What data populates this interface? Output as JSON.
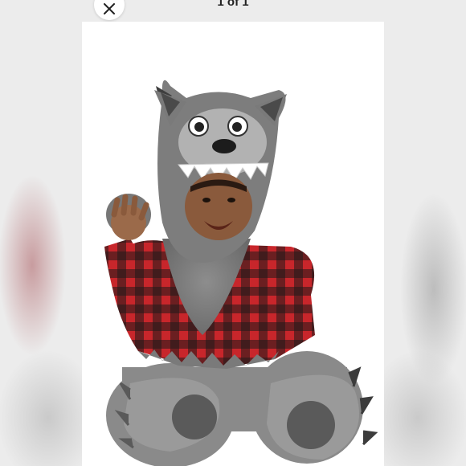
{
  "viewer": {
    "counter": "1 of 1",
    "close_icon": "close-icon"
  },
  "photo": {
    "subject": "costume-photo"
  }
}
